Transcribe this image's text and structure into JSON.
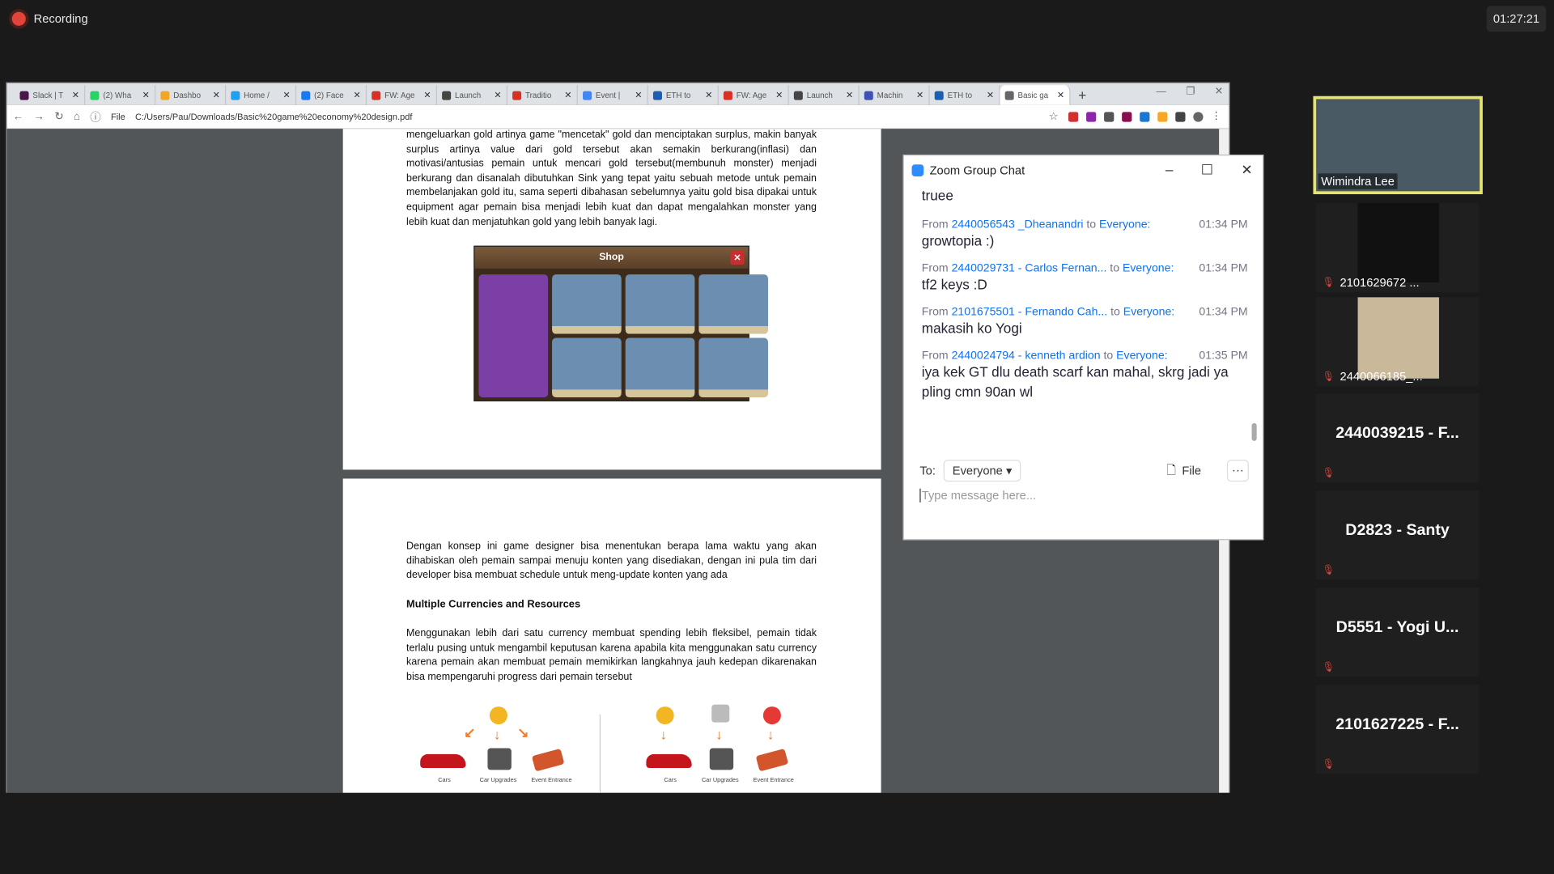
{
  "recording": {
    "label": "Recording"
  },
  "clock": "01:27:21",
  "browser": {
    "tabs": [
      {
        "title": "Slack | T",
        "color": "#4a154b"
      },
      {
        "title": "(2) Wha",
        "color": "#25d366"
      },
      {
        "title": "Dashbo",
        "color": "#f4a523"
      },
      {
        "title": "Home /",
        "color": "#1da1f2"
      },
      {
        "title": "(2) Face",
        "color": "#1877f2"
      },
      {
        "title": "FW: Age",
        "color": "#d93025"
      },
      {
        "title": "Launch",
        "color": "#444444"
      },
      {
        "title": "Traditio",
        "color": "#d93025"
      },
      {
        "title": "Event |",
        "color": "#4285f4"
      },
      {
        "title": "ETH to",
        "color": "#1a5fb4"
      },
      {
        "title": "FW: Age",
        "color": "#d93025"
      },
      {
        "title": "Launch",
        "color": "#444444"
      },
      {
        "title": "Machin",
        "color": "#3f51b5"
      },
      {
        "title": "ETH to",
        "color": "#1a5fb4"
      },
      {
        "title": "Basic ga",
        "color": "#666666"
      }
    ],
    "new_tab": "+",
    "url_prefix": "File",
    "url": "C:/Users/Pau/Downloads/Basic%20game%20economy%20design.pdf"
  },
  "pdf": {
    "p1_text": "mengeluarkan gold artinya game \"mencetak\" gold dan menciptakan surplus, makin banyak surplus artinya value dari gold tersebut akan semakin berkurang(inflasi) dan motivasi/antusias pemain untuk mencari gold tersebut(membunuh monster) menjadi berkurang dan disanalah dibutuhkan Sink yang tepat yaitu sebuah metode untuk pemain membelanjakan gold itu, sama seperti dibahasan sebelumnya yaitu gold bisa dipakai untuk equipment agar pemain bisa menjadi lebih kuat dan dapat mengalahkan monster yang lebih kuat dan menjatuhkan gold yang lebih banyak lagi.",
    "shop_title": "Shop",
    "p2_text1": "Dengan konsep ini game designer bisa menentukan berapa lama waktu yang akan dihabiskan oleh pemain sampai menuju konten yang disediakan, dengan ini pula tim dari developer bisa membuat schedule untuk meng-update konten yang ada",
    "p2_heading": "Multiple Currencies and Resources",
    "p2_text2": "Menggunakan lebih dari satu currency membuat spending lebih fleksibel, pemain tidak terlalu pusing untuk mengambil keputusan karena apabila kita menggunakan satu currency karena pemain akan membuat pemain memikirkan langkahnya jauh kedepan dikarenakan bisa mempengaruhi progress dari pemain tersebut",
    "fig_labels": [
      "Cars",
      "Car Upgrades",
      "Event Entrance"
    ]
  },
  "chat": {
    "title": "Zoom Group Chat",
    "first": "truee",
    "messages": [
      {
        "from": "2440056543 _Dheanandri",
        "to": "Everyone:",
        "time": "01:34 PM",
        "text": "growtopia :)"
      },
      {
        "from": "2440029731 - Carlos Fernan...",
        "to": "Everyone:",
        "time": "01:34 PM",
        "text": "tf2 keys :D"
      },
      {
        "from": "2101675501 - Fernando Cah...",
        "to": "Everyone:",
        "time": "01:34 PM",
        "text": "makasih ko Yogi"
      },
      {
        "from": "2440024794 - kenneth ardion",
        "to": "Everyone:",
        "time": "01:35 PM",
        "text": "iya kek GT dlu death scarf kan mahal, skrg jadi ya pling cmn 90an wl"
      }
    ],
    "from_label": "From",
    "to_label": "to",
    "to": "To:",
    "recipient": "Everyone",
    "file_label": "File",
    "placeholder": "Type message here..."
  },
  "participants": {
    "video": "Wimindra Lee",
    "thumb1": "2101629672 ...",
    "thumb2": "2440066185_...",
    "names": [
      "2440039215 - F...",
      "D2823 - Santy",
      "D5551 - Yogi U...",
      "2101627225 - F..."
    ]
  }
}
